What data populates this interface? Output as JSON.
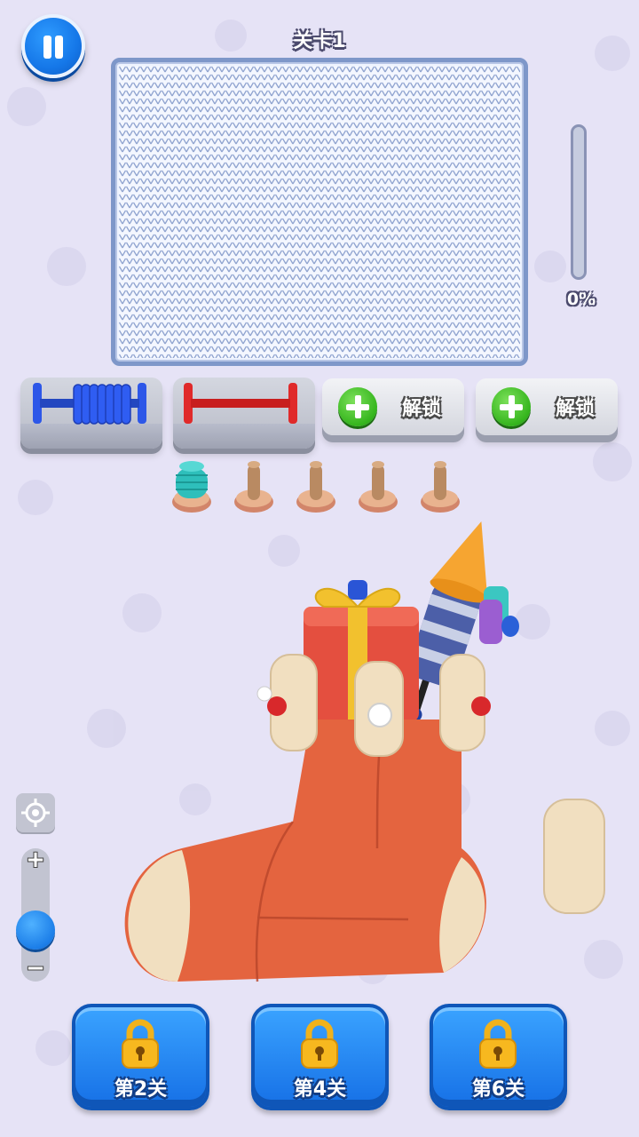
{
  "header": {
    "level_title": "关卡1"
  },
  "progress": {
    "value": 0,
    "text": "0%"
  },
  "spools": [
    {
      "color": "#2d57e8",
      "state": "filled"
    },
    {
      "color": "#e02a2a",
      "state": "empty"
    }
  ],
  "unlock_slots": [
    {
      "label": "解锁"
    },
    {
      "label": "解锁"
    }
  ],
  "pegs": [
    {
      "color": "#2fc4c0",
      "state": "wound"
    },
    {
      "state": "empty"
    },
    {
      "state": "empty"
    },
    {
      "state": "empty"
    },
    {
      "state": "empty"
    }
  ],
  "zoom": {
    "plus": "+",
    "minus": "−",
    "level": 0.45
  },
  "level_buttons": [
    {
      "label": "第2关"
    },
    {
      "label": "第4关"
    },
    {
      "label": "第6关"
    }
  ],
  "colors": {
    "background": "#e6e3f6",
    "button_blue": "#1f86f0",
    "sock": "#e4643f",
    "cream": "#f1dfc0"
  }
}
